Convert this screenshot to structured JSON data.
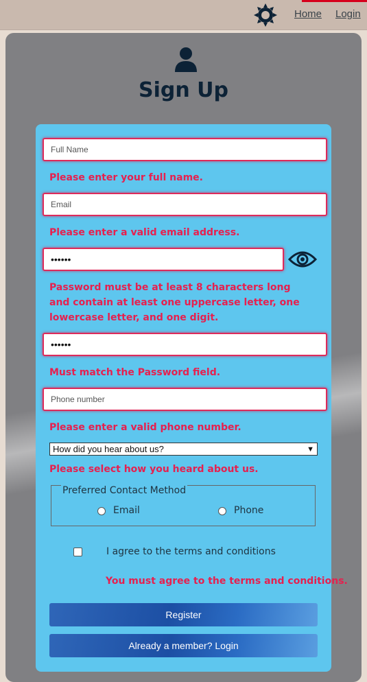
{
  "nav": {
    "home": "Home",
    "login": "Login"
  },
  "page": {
    "title": "Sign Up"
  },
  "form": {
    "full_name": {
      "placeholder": "Full Name",
      "error": "Please enter your full name."
    },
    "email": {
      "placeholder": "Email",
      "error": "Please enter a valid email address."
    },
    "password": {
      "value": "••••••",
      "error": "Password must be at least 8 characters long and contain at least one uppercase letter, one lowercase letter, and one digit."
    },
    "confirm_password": {
      "value": "••••••",
      "error": "Must match the Password field."
    },
    "phone": {
      "placeholder": "Phone number",
      "error": "Please enter a valid phone number."
    },
    "referral": {
      "selected": "How did you hear about us?",
      "error": "Please select how you heard about us."
    },
    "contact": {
      "legend": "Preferred Contact Method",
      "options": [
        "Email",
        "Phone"
      ]
    },
    "terms": {
      "label": "I agree to the terms and conditions",
      "error": "You must agree to the terms and conditions."
    },
    "register_label": "Register",
    "login_label": "Already a member? Login"
  },
  "colors": {
    "error": "#e6204f",
    "form_bg": "#5ec6ee",
    "button": "#1c4fa4"
  },
  "icons": [
    "gear-icon",
    "user-icon",
    "eye-icon"
  ]
}
